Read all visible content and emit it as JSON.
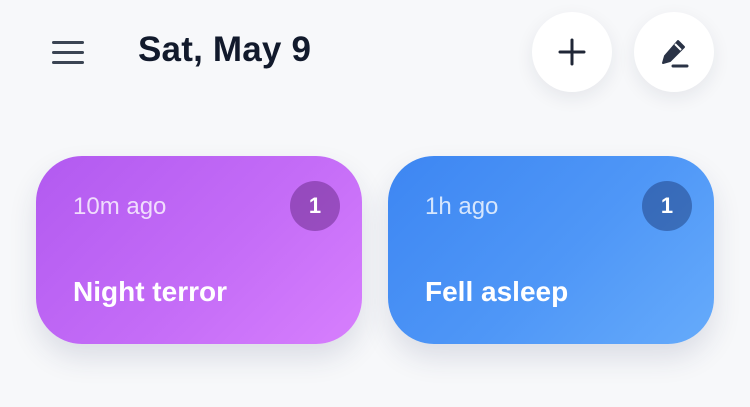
{
  "header": {
    "date_title": "Sat, May 9",
    "menu_icon": "hamburger-menu-icon",
    "add_icon": "plus-icon",
    "edit_icon": "pencil-icon"
  },
  "events": [
    {
      "time_ago": "10m ago",
      "count": "1",
      "label": "Night terror",
      "color": "#c46cf7"
    },
    {
      "time_ago": "1h ago",
      "count": "1",
      "label": "Fell asleep",
      "color": "#4f97f7"
    }
  ]
}
